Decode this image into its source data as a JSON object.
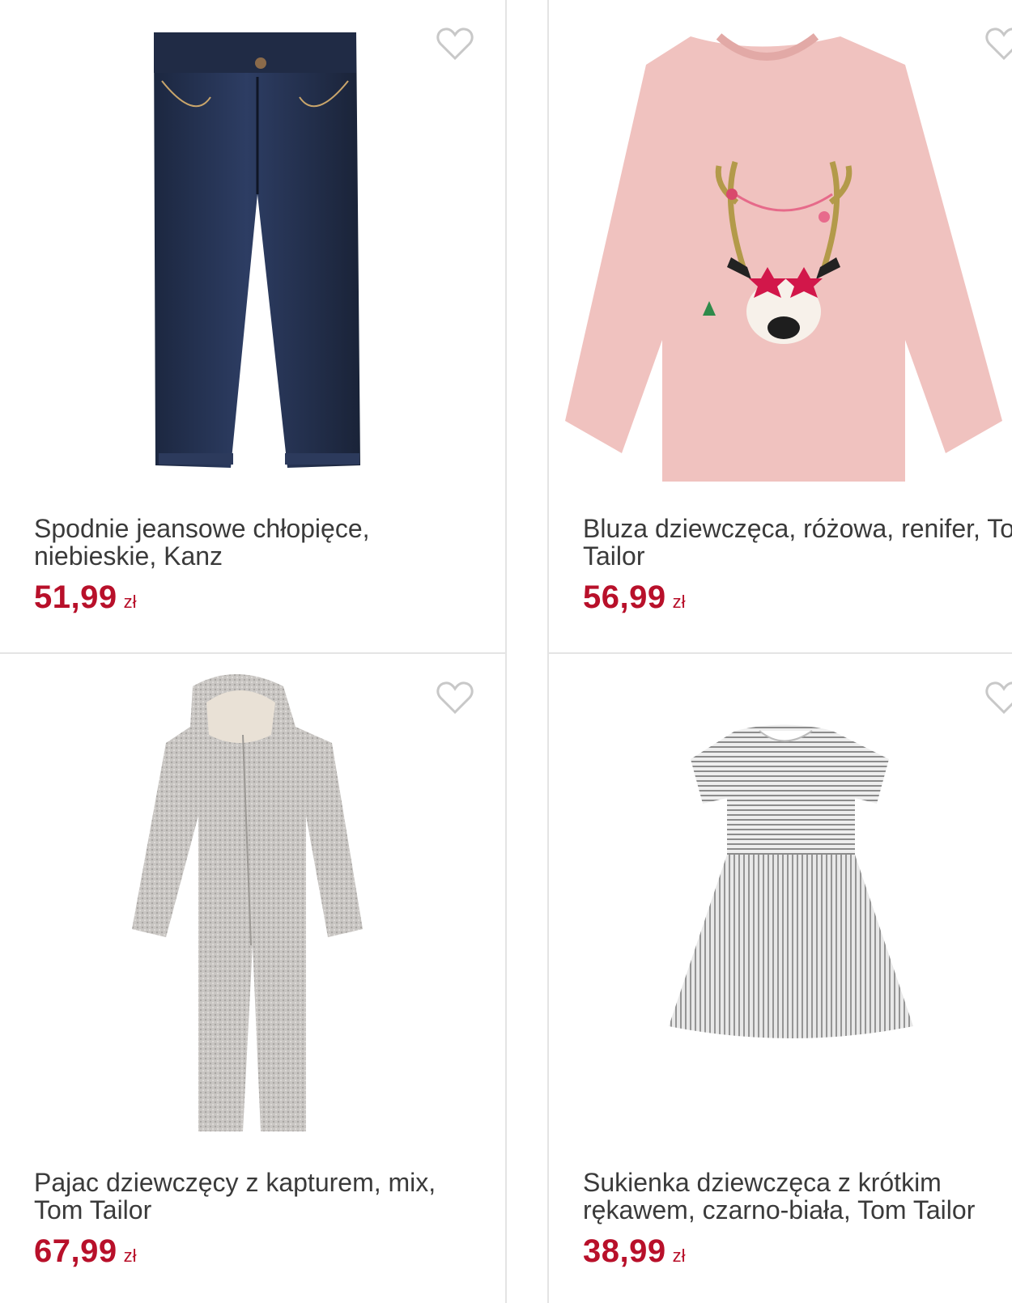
{
  "products": [
    {
      "title": "Spodnie jeansowe chłopięce, niebieskie, Kanz",
      "price": "51,99",
      "currency": "zł",
      "favorite_icon": "heart-outline-icon"
    },
    {
      "title": "Bluza dziewczęca, różowa, renifer, Tom Tailor",
      "price": "56,99",
      "currency": "zł",
      "favorite_icon": "heart-outline-icon"
    },
    {
      "title": "Pajac dziewczęcy z kapturem, mix, Tom Tailor",
      "price": "67,99",
      "currency": "zł",
      "favorite_icon": "heart-outline-icon"
    },
    {
      "title": "Sukienka dziewczęca z krótkim rękawem, czarno-biała, Tom Tailor",
      "price": "38,99",
      "currency": "zł",
      "favorite_icon": "heart-outline-icon"
    }
  ],
  "colors": {
    "price": "#b8102a",
    "title": "#3a3a3a",
    "border": "#e4e4e4",
    "heart": "#c8c8c8"
  }
}
